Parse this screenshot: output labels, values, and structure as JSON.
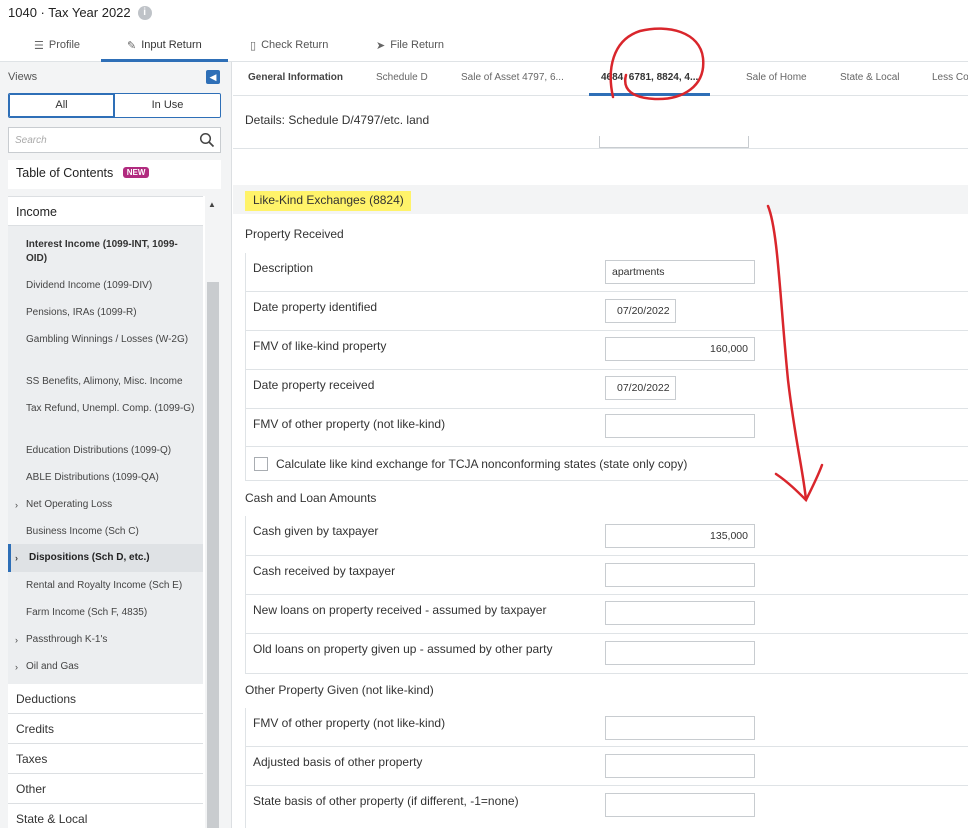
{
  "header": {
    "title": "1040 · Tax Year 2022",
    "info_icon": "info-icon",
    "tabs": [
      {
        "label": "Profile",
        "icon": "list-icon"
      },
      {
        "label": "Input Return",
        "icon": "pencil-icon"
      },
      {
        "label": "Check Return",
        "icon": "document-icon"
      },
      {
        "label": "File Return",
        "icon": "send-icon"
      }
    ]
  },
  "sidebar": {
    "views_label": "Views",
    "seg_all": "All",
    "seg_inuse": "In Use",
    "search_placeholder": "Search",
    "toc_label": "Table of Contents",
    "toc_badge": "NEW",
    "income_label": "Income",
    "income_items": [
      "Interest Income (1099-INT, 1099-OID)",
      "Dividend Income (1099-DIV)",
      "Pensions, IRAs (1099-R)",
      "Gambling Winnings / Losses (W-2G)",
      "SS Benefits, Alimony, Misc. Income",
      "Tax Refund, Unempl. Comp. (1099-G)",
      "Education Distributions (1099-Q)",
      "ABLE Distributions (1099-QA)",
      "Net Operating Loss",
      "Business Income (Sch C)",
      "Dispositions (Sch D, etc.)",
      "Rental and Royalty Income (Sch E)",
      "Farm Income (Sch F, 4835)",
      "Passthrough K-1's",
      "Oil and Gas"
    ],
    "categories": [
      "Deductions",
      "Credits",
      "Taxes",
      "Other",
      "State & Local"
    ]
  },
  "subtabs": [
    "General Information",
    "Schedule D",
    "Sale of Asset 4797, 6...",
    "4684, 6781, 8824, 4...",
    "Sale of Home",
    "State & Local",
    "Less Co"
  ],
  "main": {
    "details_label": "Details: Schedule D/4797/etc. land",
    "section_title": "Like-Kind Exchanges (8824)",
    "property_received": {
      "label": "Property Received",
      "rows": [
        {
          "label": "Description",
          "value": "apartments"
        },
        {
          "label": "Date property identified",
          "value": "07/20/2022"
        },
        {
          "label": "FMV of like-kind property",
          "value": "160,000"
        },
        {
          "label": "Date property received",
          "value": "07/20/2022"
        },
        {
          "label": "FMV of other property (not like-kind)",
          "value": ""
        }
      ],
      "checkbox_label": "Calculate like kind exchange for TCJA nonconforming states (state only copy)"
    },
    "cash_loan": {
      "label": "Cash and Loan Amounts",
      "rows": [
        {
          "label": "Cash given by taxpayer",
          "value": "135,000"
        },
        {
          "label": "Cash received by taxpayer",
          "value": ""
        },
        {
          "label": "New loans on property received - assumed by taxpayer",
          "value": ""
        },
        {
          "label": "Old loans on property given up - assumed by other party",
          "value": ""
        }
      ]
    },
    "other_given": {
      "label": "Other Property Given (not like-kind)",
      "rows": [
        {
          "label": "FMV of other property (not like-kind)",
          "value": ""
        },
        {
          "label": "Adjusted basis of other property",
          "value": ""
        },
        {
          "label": "State basis of other property (if different, -1=none)",
          "value": ""
        }
      ]
    }
  },
  "colors": {
    "accent": "#2e6fb7",
    "badge": "#b12b7f",
    "highlight": "#fff36a",
    "annotation": "#d9262c"
  }
}
